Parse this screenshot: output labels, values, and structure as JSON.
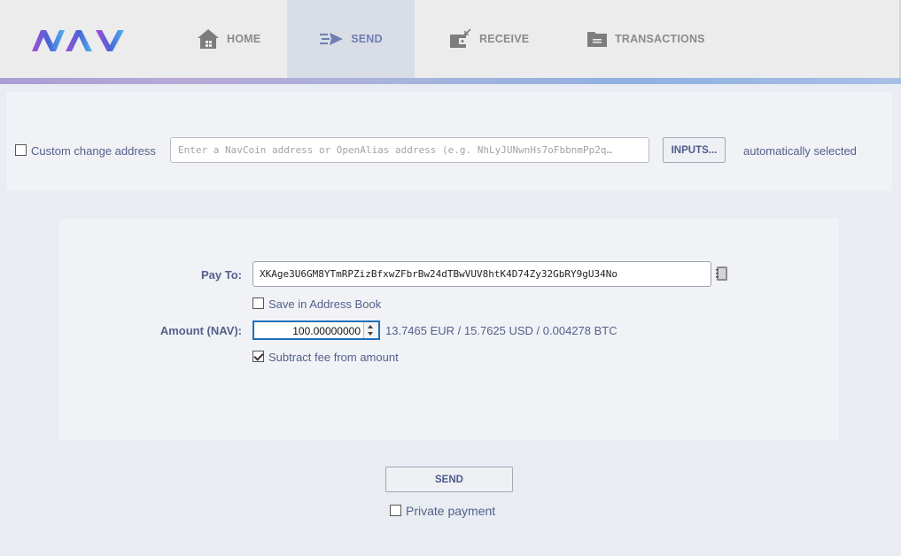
{
  "header": {
    "logo_text": "NAV",
    "tabs": [
      {
        "label": "HOME",
        "icon": "home-icon"
      },
      {
        "label": "SEND",
        "icon": "send-icon",
        "active": true
      },
      {
        "label": "RECEIVE",
        "icon": "receive-icon"
      },
      {
        "label": "TRANSACTIONS",
        "icon": "folder-icon"
      }
    ]
  },
  "coin_control": {
    "custom_change_label": "Custom change address",
    "custom_change_checked": false,
    "address_placeholder": "Enter a NavCoin address or OpenAlias address (e.g. NhLyJUNwnHs7oFbbnmPp2q…",
    "inputs_button": "INPUTS...",
    "selection_status": "automatically selected"
  },
  "form": {
    "pay_to_label": "Pay To:",
    "pay_to_value": "XKAge3U6GM8YTmRPZizBfxwZFbrBw24dTBwVUV8htK4D74Zy32GbRY9gU34No",
    "save_address_label": "Save in Address Book",
    "save_address_checked": false,
    "amount_label": "Amount (NAV):",
    "amount_value": "100.00000000",
    "amount_conversion": "13.7465 EUR / 15.7625 USD / 0.004278 BTC",
    "subtract_fee_label": "Subtract fee from amount",
    "subtract_fee_checked": true
  },
  "footer": {
    "send_button": "SEND",
    "private_payment_label": "Private payment",
    "private_payment_checked": false
  },
  "colors": {
    "accent": "#6e7fb0",
    "label": "#55608c",
    "focus_border": "#1d6fb8"
  }
}
